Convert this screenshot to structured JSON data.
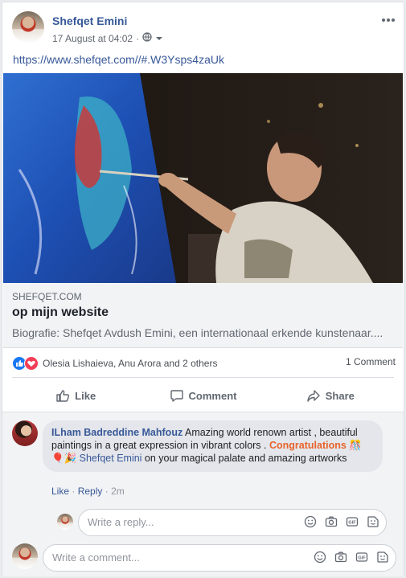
{
  "post": {
    "author": "Shefqet Emini",
    "date": "17 August at 04:02",
    "audience_icon": "globe-icon",
    "menu_icon": "more-dots-icon",
    "link_text": "https://www.shefqet.com//#.W3Ysps4zaUk"
  },
  "preview": {
    "domain": "SHEFQET.COM",
    "title": "op mijn website",
    "description": "Biografie: Shefqet Avdush Emini, een internationaal erkende kunstenaar...."
  },
  "reactions": {
    "names": "Olesia Lishaieva, Anu Arora and 2 others",
    "comment_count": "1 Comment",
    "icons": [
      "like-icon",
      "love-icon"
    ]
  },
  "actions": {
    "like": "Like",
    "comment": "Comment",
    "share": "Share"
  },
  "comment": {
    "author": "ILham Badreddine Mahfouz",
    "text_part1": " Amazing world renown artist , beautiful paintings in a great expression in vibrant colors . ",
    "congrats": "Congratulations",
    "emojis": "🎊🎈🎉",
    "tag": "Shefqet Emini",
    "text_part2": " on your magical palate and amazing artworks",
    "like": "Like",
    "reply": "Reply",
    "time": "2m"
  },
  "reply_input": {
    "placeholder": "Write a reply..."
  },
  "comment_input": {
    "placeholder": "Write a comment..."
  },
  "colors": {
    "brand_blue": "#385898",
    "like_blue": "#1877f2",
    "love_red": "#f33e58"
  }
}
